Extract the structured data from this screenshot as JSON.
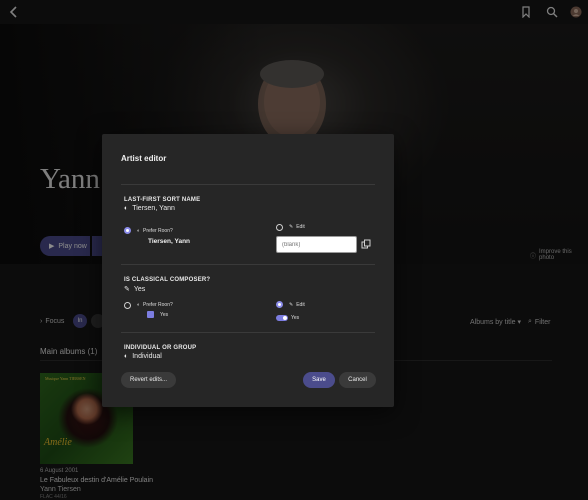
{
  "hero": {
    "artist_name": "Yann Tiersen",
    "play_label": "Play now",
    "improve_photo": "Improve this photo"
  },
  "page": {
    "focus_label": "Focus",
    "focus_chip": "In",
    "sort_label": "Albums by title",
    "filter_label": "Filter",
    "section_title": "Main albums (1)"
  },
  "album": {
    "cover_small_text": "Musique Yann TIERSEN",
    "cover_title": "Amélie",
    "date": "6 August 2001",
    "title": "Le Fabuleux destin d'Amélie Poulain",
    "artist": "Yann Tiersen",
    "format": "FLAC 44/16"
  },
  "dialog": {
    "title": "Artist editor",
    "sort_name": {
      "title": "LAST-FIRST SORT NAME",
      "current": "Tiersen, Yann",
      "prefer_roon": "Prefer Roon?",
      "roon_value": "Tiersen, Yann",
      "edit": "Edit",
      "input_placeholder": "(blank)"
    },
    "classical": {
      "title": "IS CLASSICAL COMPOSER?",
      "current": "Yes",
      "prefer_roon": "Prefer Roon?",
      "roon_value": "Yes",
      "edit": "Edit",
      "edit_value": "Yes"
    },
    "individual": {
      "title": "INDIVIDUAL OR GROUP",
      "current": "Individual"
    },
    "buttons": {
      "revert": "Revert edits...",
      "save": "Save",
      "cancel": "Cancel"
    }
  },
  "colors": {
    "accent": "#4b4c8c",
    "accent_light": "#7c7de0",
    "dialog_bg": "#262626",
    "page_bg": "#161616"
  }
}
